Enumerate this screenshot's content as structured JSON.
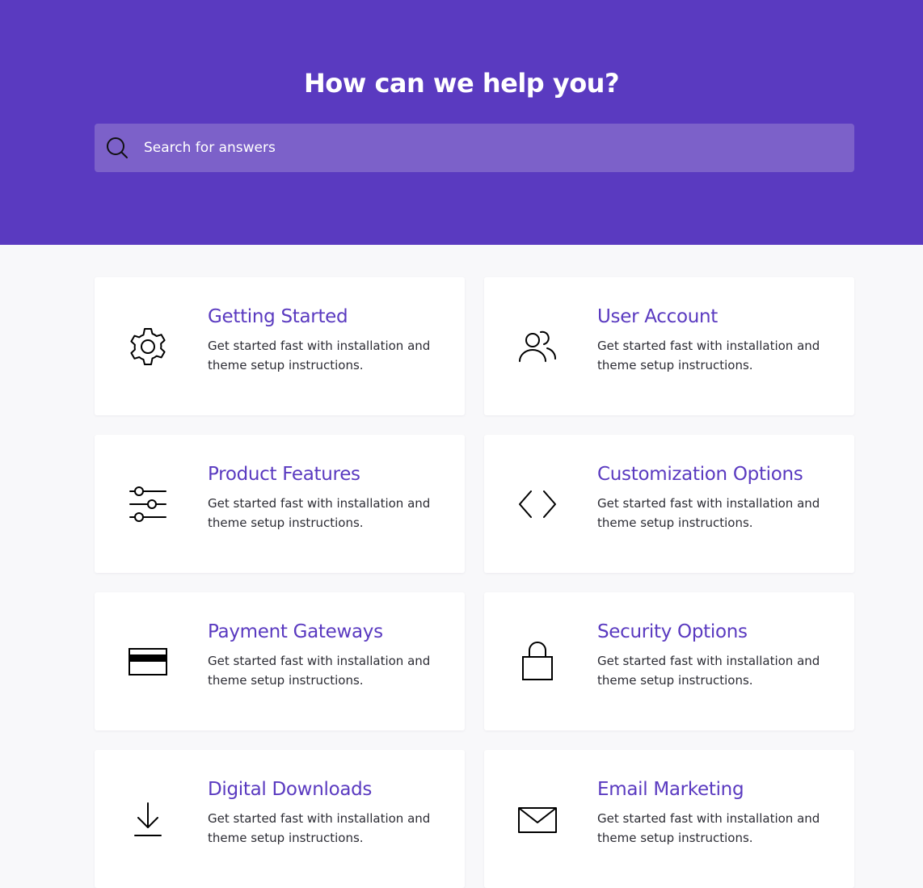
{
  "hero": {
    "title": "How can we help you?",
    "search_placeholder": "Search for answers",
    "background_color": "#5a3ac0",
    "search_icon": "search-icon"
  },
  "accent_color": "#5a3ac0",
  "cards": [
    {
      "title": "Getting Started",
      "description": "Get started fast with installation and theme setup instructions.",
      "icon": "gear-icon"
    },
    {
      "title": "User Account",
      "description": "Get started fast with installation and theme setup instructions.",
      "icon": "users-icon"
    },
    {
      "title": "Product Features",
      "description": "Get started fast with installation and theme setup instructions.",
      "icon": "sliders-icon"
    },
    {
      "title": "Customization Options",
      "description": "Get started fast with installation and theme setup instructions.",
      "icon": "code-icon"
    },
    {
      "title": "Payment Gateways",
      "description": "Get started fast with installation and theme setup instructions.",
      "icon": "credit-card-icon"
    },
    {
      "title": "Security Options",
      "description": "Get started fast with installation and theme setup instructions.",
      "icon": "lock-icon"
    },
    {
      "title": "Digital Downloads",
      "description": "Get started fast with installation and theme setup instructions.",
      "icon": "download-icon"
    },
    {
      "title": "Email Marketing",
      "description": "Get started fast with installation and theme setup instructions.",
      "icon": "envelope-icon"
    }
  ]
}
